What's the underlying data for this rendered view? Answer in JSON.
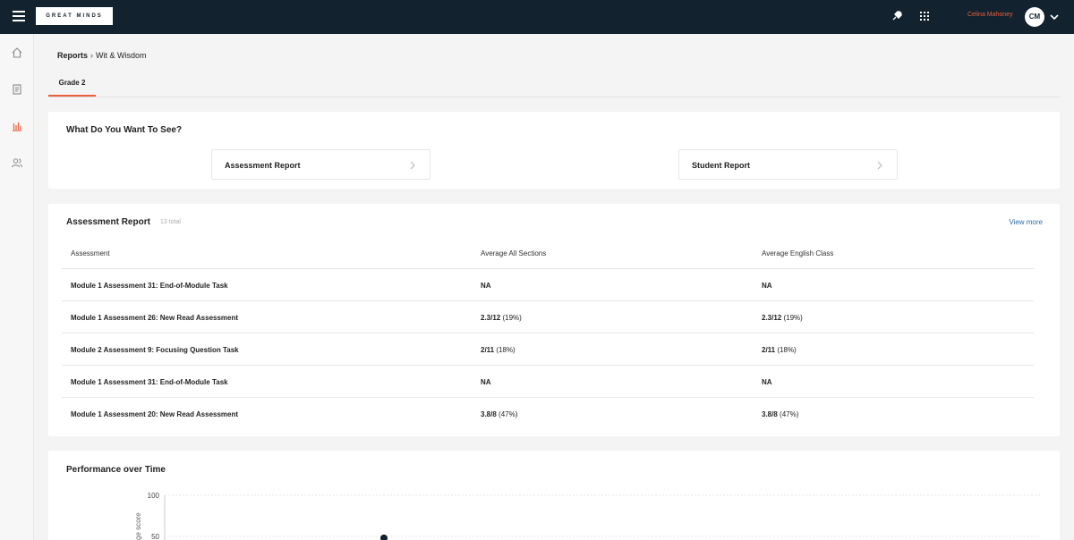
{
  "header": {
    "logo": "GREAT MINDS",
    "user_name": "Celina Mahoney",
    "user_initials": "CM"
  },
  "sidebar": {
    "items": [
      "home-icon",
      "book-icon",
      "reports-icon",
      "users-icon"
    ],
    "active_color": "#e8603c"
  },
  "breadcrumb": {
    "root": "Reports",
    "current": "Wit & Wisdom"
  },
  "tabs": [
    {
      "label": "Grade 2",
      "active": true
    }
  ],
  "selector": {
    "title": "What Do You Want To See?",
    "options": [
      {
        "label": "Assessment Report"
      },
      {
        "label": "Student Report"
      }
    ]
  },
  "assessment_report": {
    "title": "Assessment Report",
    "total": "13 total",
    "view_more": "View more",
    "columns": [
      "Assessment",
      "Average All Sections",
      "Average English Class"
    ],
    "rows": [
      {
        "name": "Module 1 Assessment 31: End-of-Module Task",
        "all_score": "NA",
        "all_pct": "",
        "eng_score": "NA",
        "eng_pct": ""
      },
      {
        "name": "Module 1 Assessment 26: New Read Assessment",
        "all_score": "2.3/12",
        "all_pct": "(19%)",
        "eng_score": "2.3/12",
        "eng_pct": "(19%)"
      },
      {
        "name": "Module 2 Assessment 9: Focusing Question Task",
        "all_score": "2/11",
        "all_pct": "(18%)",
        "eng_score": "2/11",
        "eng_pct": "(18%)"
      },
      {
        "name": "Module 1 Assessment 31: End-of-Module Task",
        "all_score": "NA",
        "all_pct": "",
        "eng_score": "NA",
        "eng_pct": ""
      },
      {
        "name": "Module 1 Assessment 20: New Read Assessment",
        "all_score": "3.8/8",
        "all_pct": "(47%)",
        "eng_score": "3.8/8",
        "eng_pct": "(47%)"
      }
    ]
  },
  "performance": {
    "title": "Performance over Time"
  },
  "chart_data": {
    "type": "line",
    "title": "Performance over Time",
    "xlabel": "",
    "ylabel": "ge score",
    "yticks": [
      100,
      50
    ],
    "ylim": [
      0,
      100
    ],
    "grid": true,
    "series": [
      {
        "points": [
          {
            "x_fraction": 0.25,
            "y": 48
          }
        ]
      }
    ],
    "line_color": "#13222f"
  }
}
